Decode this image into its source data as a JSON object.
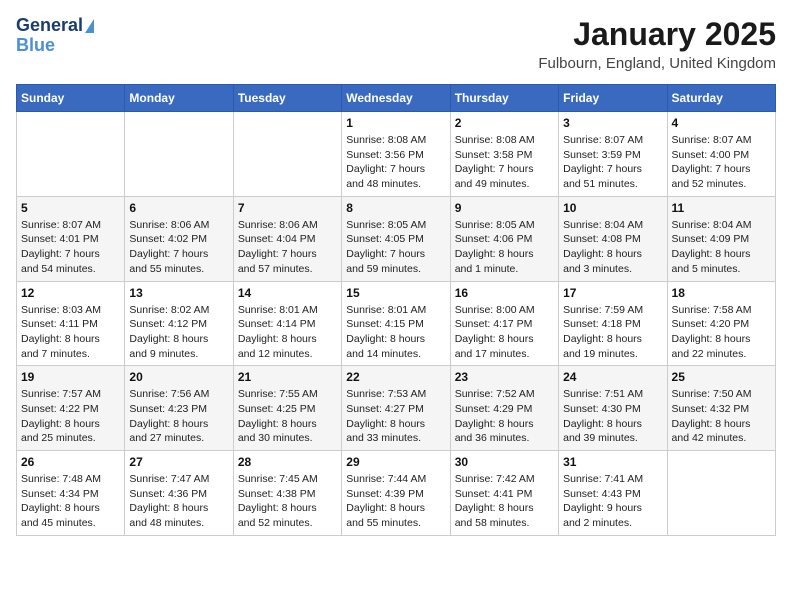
{
  "logo": {
    "line1": "General",
    "line2": "Blue"
  },
  "title": "January 2025",
  "subtitle": "Fulbourn, England, United Kingdom",
  "days_header": [
    "Sunday",
    "Monday",
    "Tuesday",
    "Wednesday",
    "Thursday",
    "Friday",
    "Saturday"
  ],
  "weeks": [
    [
      {
        "num": "",
        "info": ""
      },
      {
        "num": "",
        "info": ""
      },
      {
        "num": "",
        "info": ""
      },
      {
        "num": "1",
        "info": "Sunrise: 8:08 AM\nSunset: 3:56 PM\nDaylight: 7 hours\nand 48 minutes."
      },
      {
        "num": "2",
        "info": "Sunrise: 8:08 AM\nSunset: 3:58 PM\nDaylight: 7 hours\nand 49 minutes."
      },
      {
        "num": "3",
        "info": "Sunrise: 8:07 AM\nSunset: 3:59 PM\nDaylight: 7 hours\nand 51 minutes."
      },
      {
        "num": "4",
        "info": "Sunrise: 8:07 AM\nSunset: 4:00 PM\nDaylight: 7 hours\nand 52 minutes."
      }
    ],
    [
      {
        "num": "5",
        "info": "Sunrise: 8:07 AM\nSunset: 4:01 PM\nDaylight: 7 hours\nand 54 minutes."
      },
      {
        "num": "6",
        "info": "Sunrise: 8:06 AM\nSunset: 4:02 PM\nDaylight: 7 hours\nand 55 minutes."
      },
      {
        "num": "7",
        "info": "Sunrise: 8:06 AM\nSunset: 4:04 PM\nDaylight: 7 hours\nand 57 minutes."
      },
      {
        "num": "8",
        "info": "Sunrise: 8:05 AM\nSunset: 4:05 PM\nDaylight: 7 hours\nand 59 minutes."
      },
      {
        "num": "9",
        "info": "Sunrise: 8:05 AM\nSunset: 4:06 PM\nDaylight: 8 hours\nand 1 minute."
      },
      {
        "num": "10",
        "info": "Sunrise: 8:04 AM\nSunset: 4:08 PM\nDaylight: 8 hours\nand 3 minutes."
      },
      {
        "num": "11",
        "info": "Sunrise: 8:04 AM\nSunset: 4:09 PM\nDaylight: 8 hours\nand 5 minutes."
      }
    ],
    [
      {
        "num": "12",
        "info": "Sunrise: 8:03 AM\nSunset: 4:11 PM\nDaylight: 8 hours\nand 7 minutes."
      },
      {
        "num": "13",
        "info": "Sunrise: 8:02 AM\nSunset: 4:12 PM\nDaylight: 8 hours\nand 9 minutes."
      },
      {
        "num": "14",
        "info": "Sunrise: 8:01 AM\nSunset: 4:14 PM\nDaylight: 8 hours\nand 12 minutes."
      },
      {
        "num": "15",
        "info": "Sunrise: 8:01 AM\nSunset: 4:15 PM\nDaylight: 8 hours\nand 14 minutes."
      },
      {
        "num": "16",
        "info": "Sunrise: 8:00 AM\nSunset: 4:17 PM\nDaylight: 8 hours\nand 17 minutes."
      },
      {
        "num": "17",
        "info": "Sunrise: 7:59 AM\nSunset: 4:18 PM\nDaylight: 8 hours\nand 19 minutes."
      },
      {
        "num": "18",
        "info": "Sunrise: 7:58 AM\nSunset: 4:20 PM\nDaylight: 8 hours\nand 22 minutes."
      }
    ],
    [
      {
        "num": "19",
        "info": "Sunrise: 7:57 AM\nSunset: 4:22 PM\nDaylight: 8 hours\nand 25 minutes."
      },
      {
        "num": "20",
        "info": "Sunrise: 7:56 AM\nSunset: 4:23 PM\nDaylight: 8 hours\nand 27 minutes."
      },
      {
        "num": "21",
        "info": "Sunrise: 7:55 AM\nSunset: 4:25 PM\nDaylight: 8 hours\nand 30 minutes."
      },
      {
        "num": "22",
        "info": "Sunrise: 7:53 AM\nSunset: 4:27 PM\nDaylight: 8 hours\nand 33 minutes."
      },
      {
        "num": "23",
        "info": "Sunrise: 7:52 AM\nSunset: 4:29 PM\nDaylight: 8 hours\nand 36 minutes."
      },
      {
        "num": "24",
        "info": "Sunrise: 7:51 AM\nSunset: 4:30 PM\nDaylight: 8 hours\nand 39 minutes."
      },
      {
        "num": "25",
        "info": "Sunrise: 7:50 AM\nSunset: 4:32 PM\nDaylight: 8 hours\nand 42 minutes."
      }
    ],
    [
      {
        "num": "26",
        "info": "Sunrise: 7:48 AM\nSunset: 4:34 PM\nDaylight: 8 hours\nand 45 minutes."
      },
      {
        "num": "27",
        "info": "Sunrise: 7:47 AM\nSunset: 4:36 PM\nDaylight: 8 hours\nand 48 minutes."
      },
      {
        "num": "28",
        "info": "Sunrise: 7:45 AM\nSunset: 4:38 PM\nDaylight: 8 hours\nand 52 minutes."
      },
      {
        "num": "29",
        "info": "Sunrise: 7:44 AM\nSunset: 4:39 PM\nDaylight: 8 hours\nand 55 minutes."
      },
      {
        "num": "30",
        "info": "Sunrise: 7:42 AM\nSunset: 4:41 PM\nDaylight: 8 hours\nand 58 minutes."
      },
      {
        "num": "31",
        "info": "Sunrise: 7:41 AM\nSunset: 4:43 PM\nDaylight: 9 hours\nand 2 minutes."
      },
      {
        "num": "",
        "info": ""
      }
    ]
  ]
}
